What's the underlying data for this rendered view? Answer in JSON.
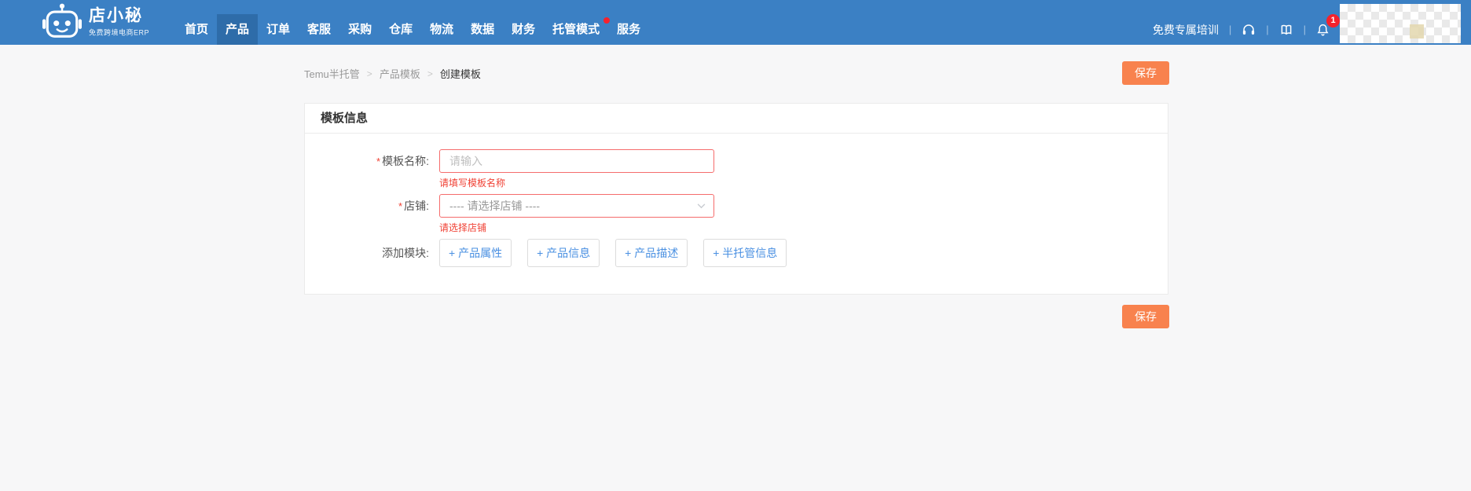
{
  "navbar": {
    "logo_title": "店小秘",
    "logo_subtitle": "免费跨境电商ERP",
    "items": [
      {
        "label": "首页",
        "active": false
      },
      {
        "label": "产品",
        "active": true
      },
      {
        "label": "订单",
        "active": false
      },
      {
        "label": "客服",
        "active": false
      },
      {
        "label": "采购",
        "active": false
      },
      {
        "label": "仓库",
        "active": false
      },
      {
        "label": "物流",
        "active": false
      },
      {
        "label": "数据",
        "active": false
      },
      {
        "label": "财务",
        "active": false
      },
      {
        "label": "托管模式",
        "active": false,
        "has_red_dot": true
      },
      {
        "label": "服务",
        "active": false
      }
    ],
    "training_label": "免费专属培训",
    "notification_count": "1",
    "icons": [
      "headset-icon",
      "book-icon",
      "bell-icon"
    ]
  },
  "breadcrumb": {
    "items": [
      "Temu半托管",
      "产品模板",
      "创建模板"
    ],
    "separator": ">"
  },
  "save_button_label": "保存",
  "card": {
    "title": "模板信息",
    "required_marker": "*",
    "template_name": {
      "label": "模板名称:",
      "value": "",
      "placeholder": "请输入",
      "error": "请填写模板名称"
    },
    "shop": {
      "label": "店铺:",
      "placeholder": "---- 请选择店铺 ----",
      "error": "请选择店铺"
    },
    "modules": {
      "label": "添加模块:",
      "buttons": [
        "+ 产品属性",
        "+ 产品信息",
        "+ 产品描述",
        "+ 半托管信息"
      ]
    }
  },
  "colors": {
    "navbar_blue": "#3b80c4",
    "navbar_active_blue": "#2e6ca9",
    "accent_orange": "#f8824e",
    "error_red": "#f04134",
    "input_error_border": "#f56c6c",
    "module_link_blue": "#4a90e2",
    "badge_red": "#f5222d",
    "page_background": "#f7f7f8"
  }
}
